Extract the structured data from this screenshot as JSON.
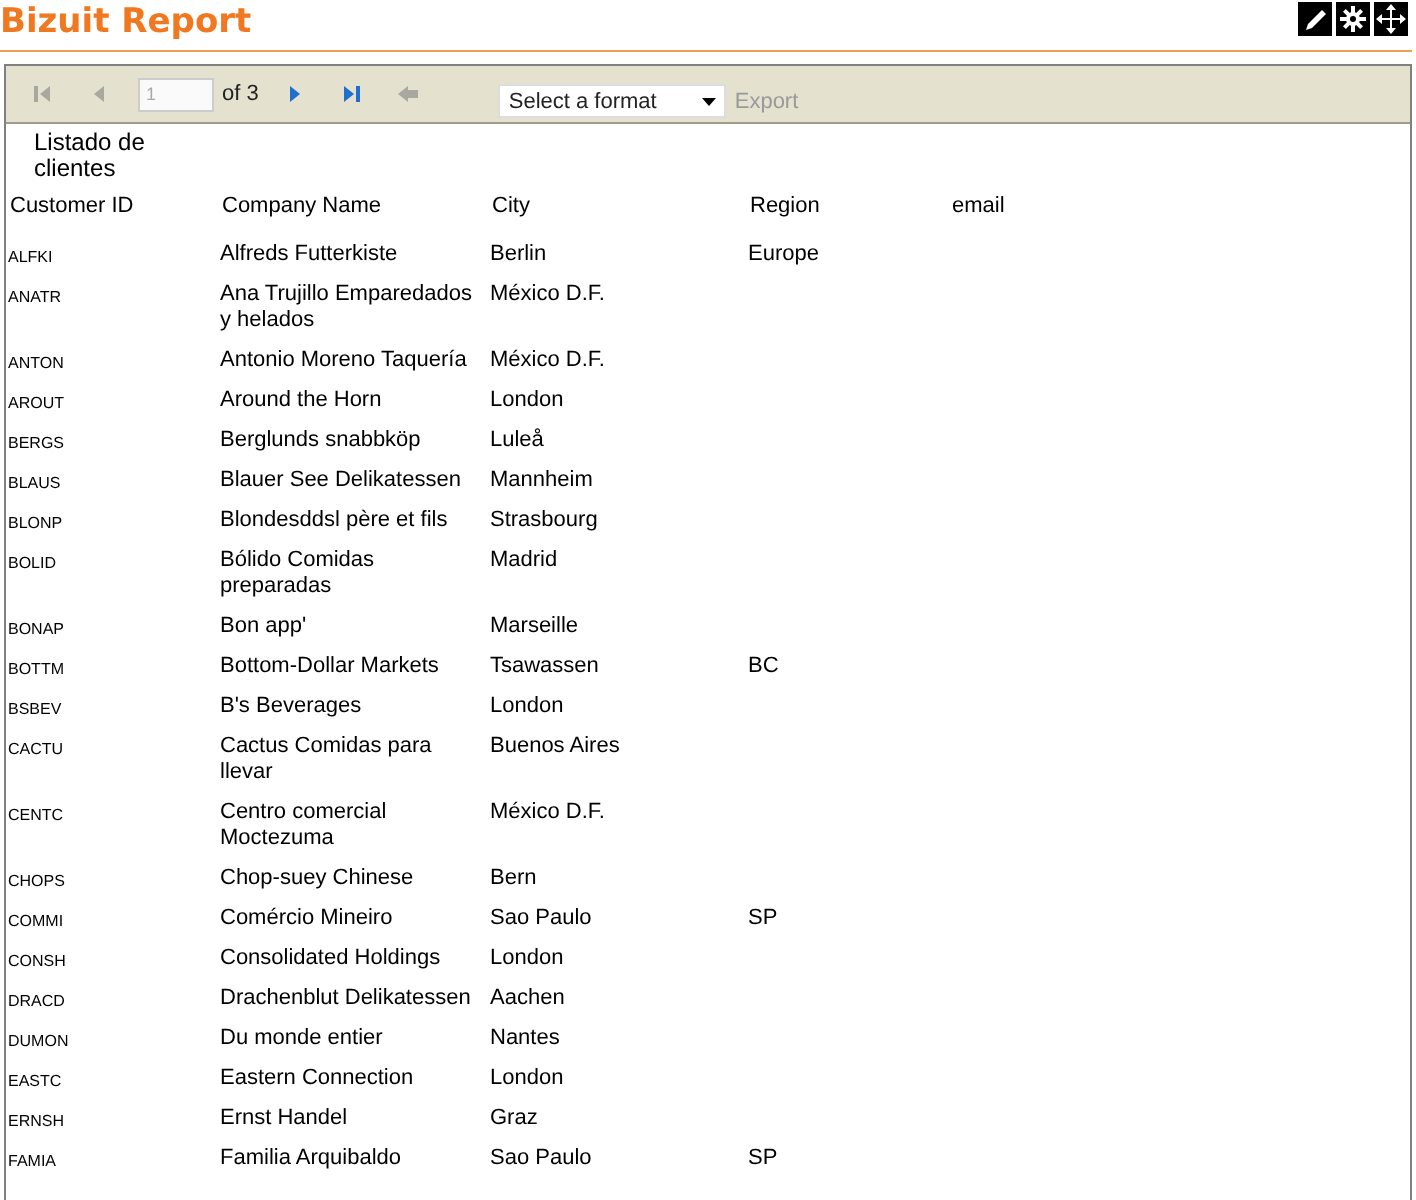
{
  "header": {
    "title": "Bizuit Report",
    "tools": [
      {
        "kind": "edit"
      },
      {
        "kind": "settings"
      },
      {
        "kind": "move"
      }
    ]
  },
  "toolbar": {
    "pager": [
      {
        "kind": "first",
        "disabled": true
      },
      {
        "kind": "prev",
        "disabled": true
      }
    ],
    "page_input": {
      "value": "1",
      "disabled": true
    },
    "page_count": "of 3",
    "pager_after": [
      {
        "kind": "next",
        "disabled": false
      },
      {
        "kind": "last",
        "disabled": false
      },
      {
        "kind": "back",
        "disabled": true
      }
    ],
    "format_select": {
      "value": "Select a format"
    },
    "export": {
      "label": "Export",
      "disabled": true
    }
  },
  "report": {
    "title": "Listado de clientes",
    "columns": [
      "Customer ID",
      "Company Name",
      "City",
      "Region",
      "email"
    ],
    "rows": [
      [
        "ALFKI",
        "Alfreds Futterkiste",
        "Berlin",
        "Europe",
        ""
      ],
      [
        "ANATR",
        "Ana Trujillo Emparedados y helados",
        "México D.F.",
        "",
        ""
      ],
      [
        "ANTON",
        "Antonio Moreno Taquería",
        "México D.F.",
        "",
        ""
      ],
      [
        "AROUT",
        "Around the Horn",
        "London",
        "",
        ""
      ],
      [
        "BERGS",
        "Berglunds snabbköp",
        "Luleå",
        "",
        ""
      ],
      [
        "BLAUS",
        "Blauer See Delikatessen",
        "Mannheim",
        "",
        ""
      ],
      [
        "BLONP",
        "Blondesddsl père et fils",
        "Strasbourg",
        "",
        ""
      ],
      [
        "BOLID",
        "Bólido Comidas preparadas",
        "Madrid",
        "",
        ""
      ],
      [
        "BONAP",
        "Bon app'",
        "Marseille",
        "",
        ""
      ],
      [
        "BOTTM",
        "Bottom-Dollar Markets",
        "Tsawassen",
        "BC",
        ""
      ],
      [
        "BSBEV",
        "B's Beverages",
        "London",
        "",
        ""
      ],
      [
        "CACTU",
        "Cactus Comidas para llevar",
        "Buenos Aires",
        "",
        ""
      ],
      [
        "CENTC",
        "Centro comercial Moctezuma",
        "México D.F.",
        "",
        ""
      ],
      [
        "CHOPS",
        "Chop-suey Chinese",
        "Bern",
        "",
        ""
      ],
      [
        "COMMI",
        "Comércio Mineiro",
        "Sao Paulo",
        "SP",
        ""
      ],
      [
        "CONSH",
        "Consolidated Holdings",
        "London",
        "",
        ""
      ],
      [
        "DRACD",
        "Drachenblut Delikatessen",
        "Aachen",
        "",
        ""
      ],
      [
        "DUMON",
        "Du monde entier",
        "Nantes",
        "",
        ""
      ],
      [
        "EASTC",
        "Eastern Connection",
        "London",
        "",
        ""
      ],
      [
        "ERNSH",
        "Ernst Handel",
        "Graz",
        "",
        ""
      ],
      [
        "FAMIA",
        "Familia Arquibaldo",
        "Sao Paulo",
        "SP",
        ""
      ]
    ]
  }
}
